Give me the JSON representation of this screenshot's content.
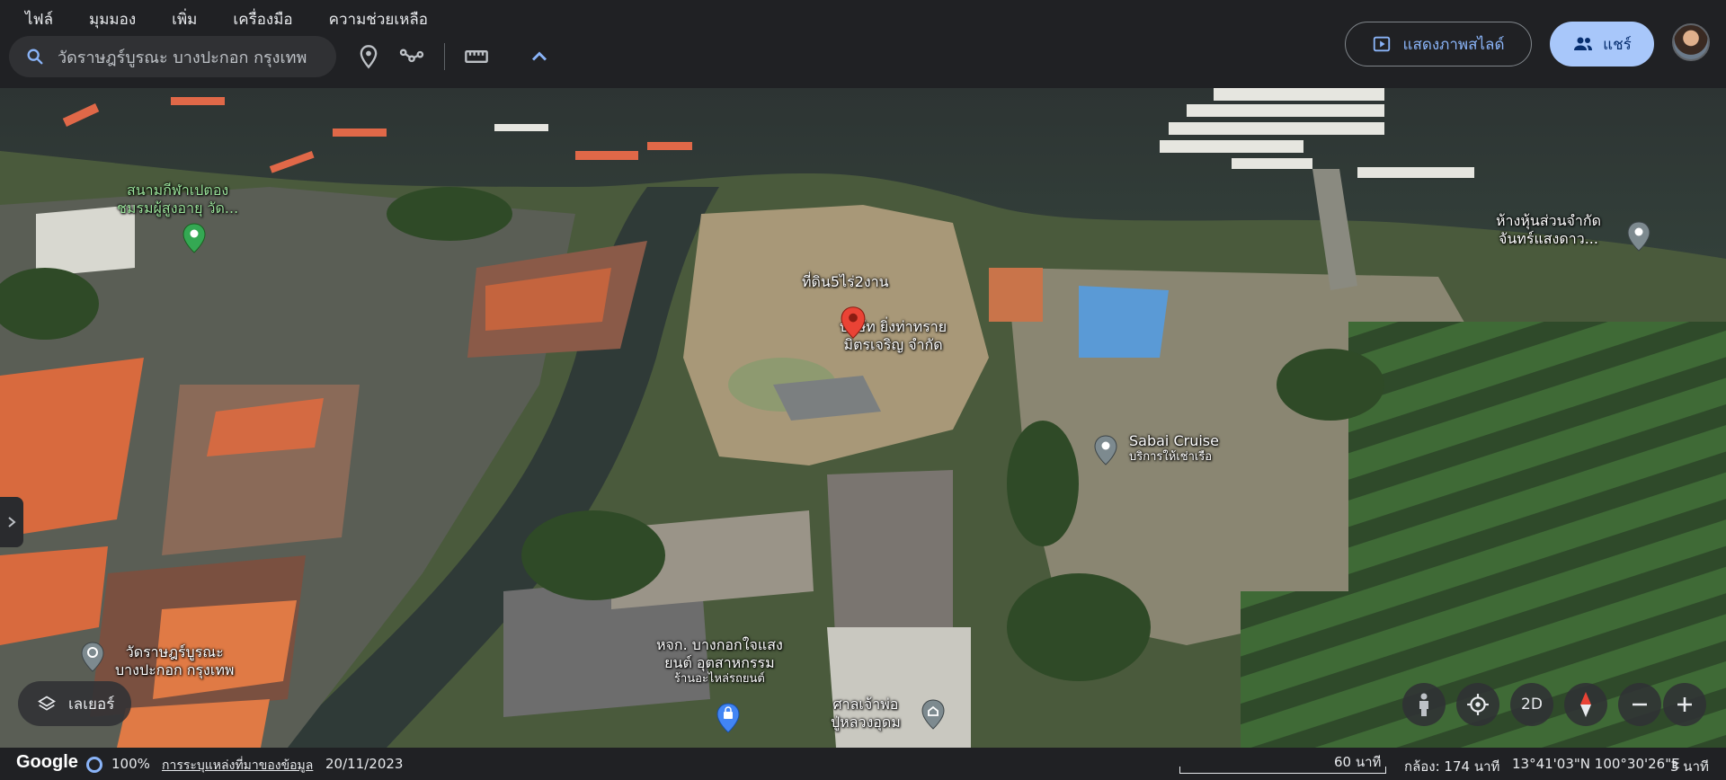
{
  "menu": [
    "ไฟล์",
    "มุมมอง",
    "เพิ่ม",
    "เครื่องมือ",
    "ความช่วยเหลือ"
  ],
  "search": {
    "value": "วัดราษฎร์บูรณะ บางปะกอก กรุงเทพ"
  },
  "toolbar": {
    "slideshow_label": "แสดงภาพสไลด์",
    "share_label": "แชร์"
  },
  "map_labels": {
    "golf": [
      "สนามกีฬาเปตอง",
      "ชมรมผู้สูงอายุ วัด..."
    ],
    "land": "ที่ดิน5ไร่2งาน",
    "company": [
      "บริษัท ยิ่งท่าทราย",
      "มิตรเจริญ จำกัด"
    ],
    "partnership": [
      "ห้างหุ้นส่วนจำกัด",
      "จันทร์แสงดาว..."
    ],
    "sabai_name": "Sabai Cruise",
    "sabai_sub": "บริการให้เช่าเรือ",
    "temple": [
      "วัดราษฎร์บูรณะ",
      "บางปะกอก กรุงเทพ"
    ],
    "dealer": [
      "หจก. บางกอกใจแสง",
      "ยนต์ อุตสาหกรรม"
    ],
    "dealer_sub": "ร้านอะไหล่รถยนต์",
    "shrine": [
      "ศาลเจ้าพ่อ",
      "ปู่หลวงอุดม"
    ]
  },
  "controls": {
    "layers_label": "เลเยอร์",
    "view_mode": "2D"
  },
  "status": {
    "zoom": "100%",
    "data_sources": "การระบุแหล่งที่มาของข้อมูล",
    "date": "20/11/2023",
    "scale": "60 นาที",
    "camera": "กล้อง: 174 นาที",
    "coords": "13°41'03\"N 100°30'26\"E",
    "altitude": "3 นาที",
    "brand": "Google"
  },
  "colors": {
    "accent": "#8ab4f8",
    "share_bg": "#a8c7fa",
    "pin_red": "#ea4335",
    "pin_green": "#34a853",
    "pin_gray": "#7d8a8f",
    "pin_blue": "#4285f4"
  }
}
